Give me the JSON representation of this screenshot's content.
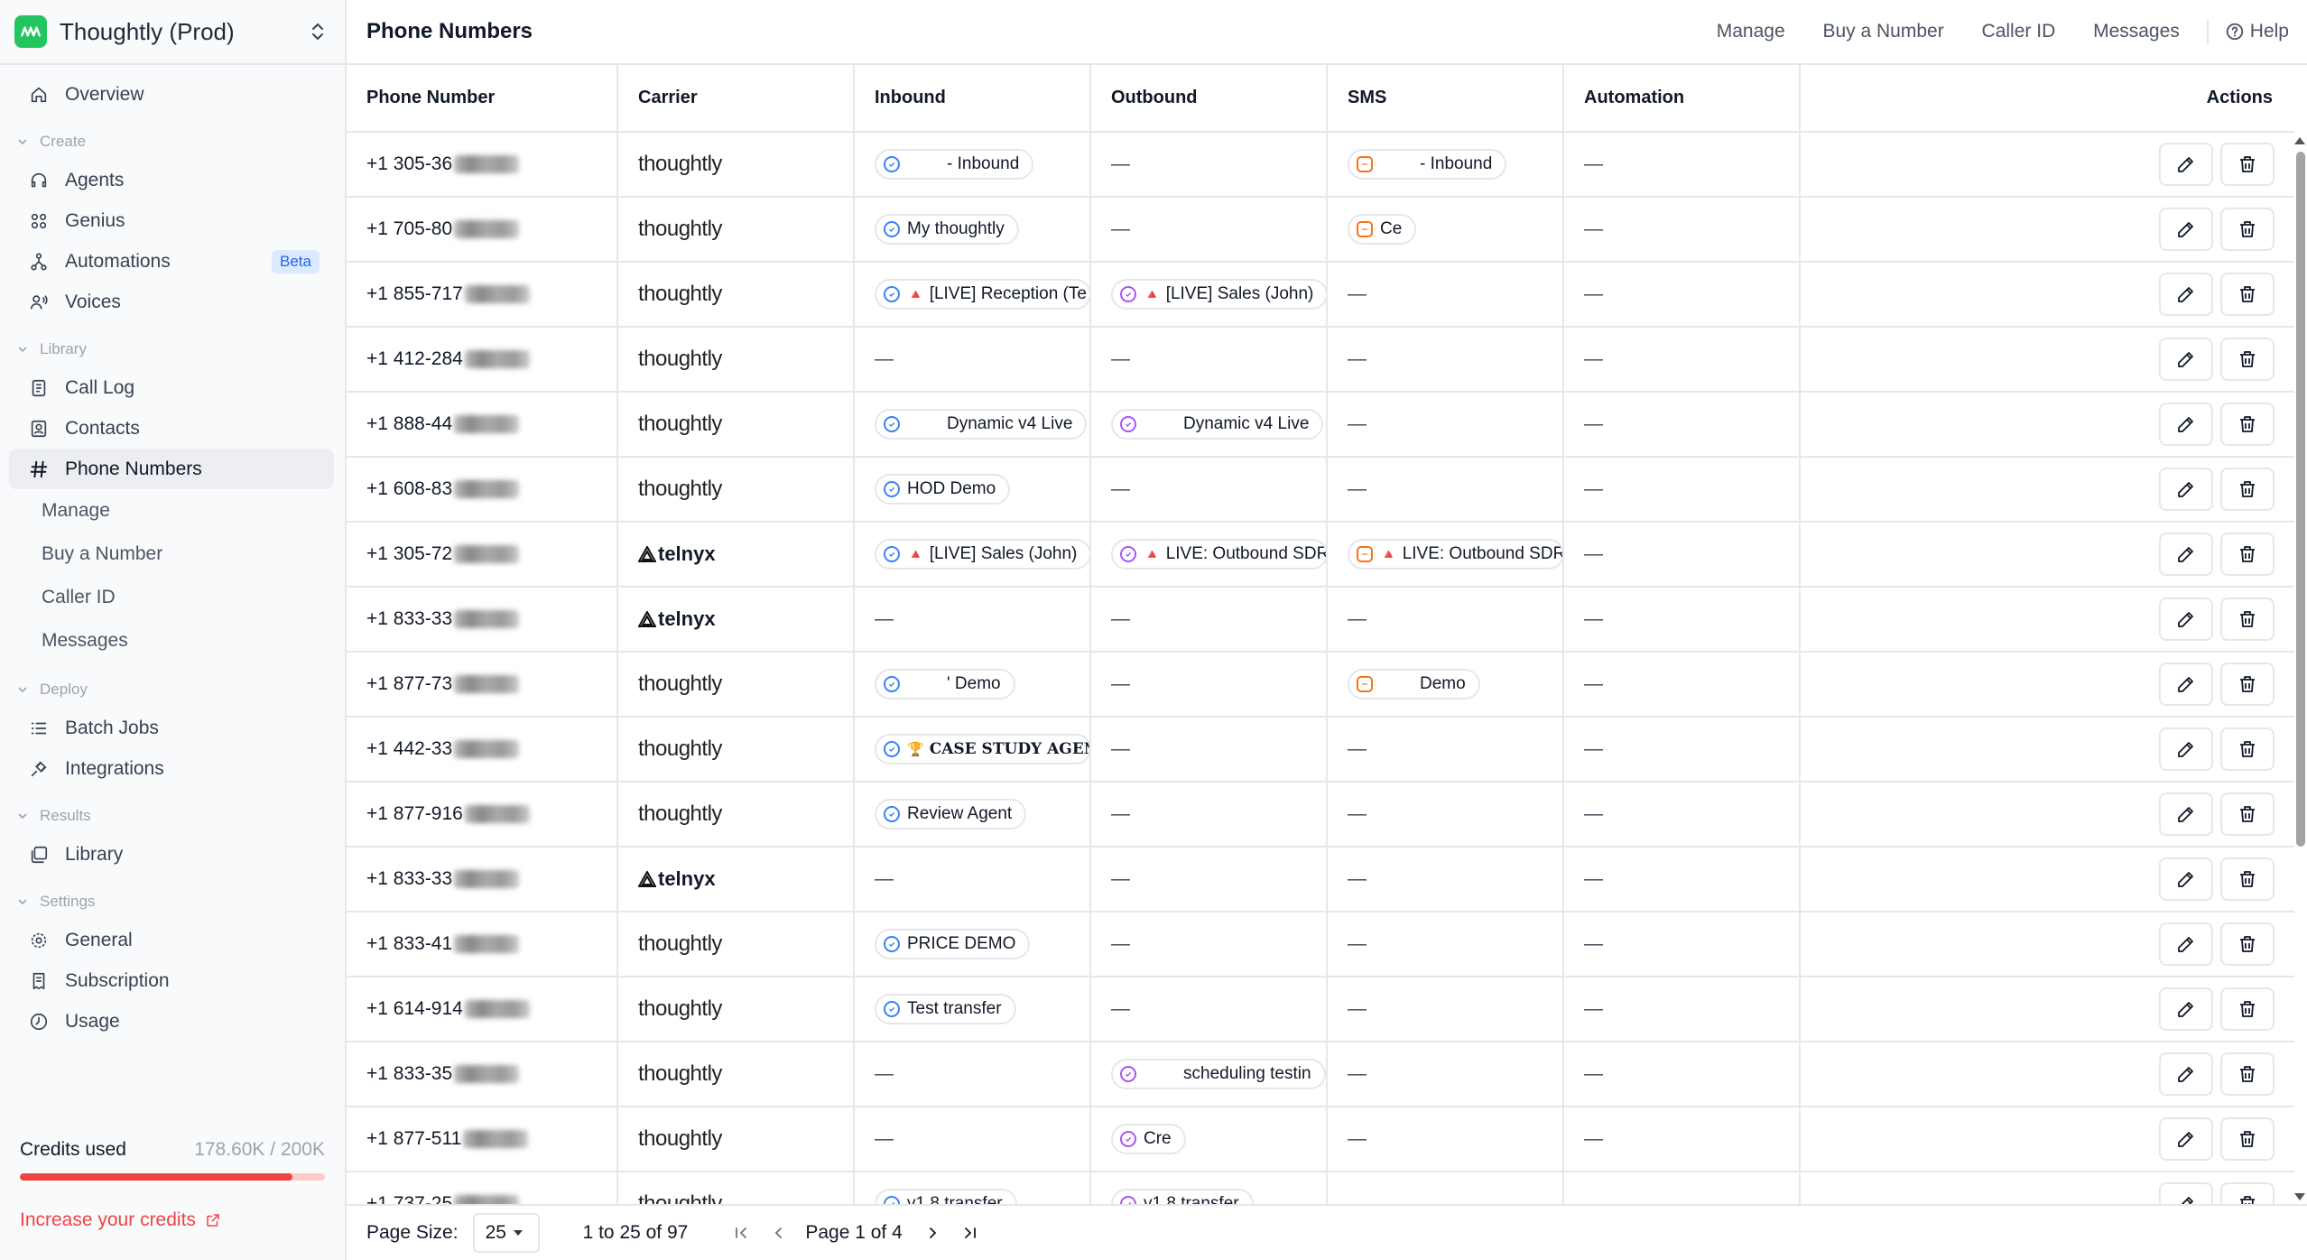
{
  "workspace": {
    "name": "Thoughtly (Prod)"
  },
  "sidebar": {
    "overview": "Overview",
    "sections": {
      "create": "Create",
      "library": "Library",
      "deploy": "Deploy",
      "results": "Results",
      "settings": "Settings"
    },
    "create_items": [
      {
        "label": "Agents",
        "icon": "headset-icon"
      },
      {
        "label": "Genius",
        "icon": "grid-icon"
      },
      {
        "label": "Automations",
        "icon": "flow-icon",
        "badge": "Beta"
      },
      {
        "label": "Voices",
        "icon": "voices-icon"
      }
    ],
    "library_items": [
      {
        "label": "Call Log",
        "icon": "call-log-icon"
      },
      {
        "label": "Contacts",
        "icon": "contacts-icon"
      },
      {
        "label": "Phone Numbers",
        "icon": "hash-icon"
      }
    ],
    "phone_sub": [
      "Manage",
      "Buy a Number",
      "Caller ID",
      "Messages"
    ],
    "deploy_items": [
      {
        "label": "Batch Jobs",
        "icon": "list-icon"
      },
      {
        "label": "Integrations",
        "icon": "plug-icon"
      }
    ],
    "results_items": [
      {
        "label": "Library",
        "icon": "library-icon"
      }
    ],
    "settings_items": [
      {
        "label": "General",
        "icon": "gear-icon"
      },
      {
        "label": "Subscription",
        "icon": "receipt-icon"
      },
      {
        "label": "Usage",
        "icon": "clock-icon"
      }
    ],
    "credits": {
      "label": "Credits used",
      "value": "178.60K / 200K",
      "fraction": 0.893
    },
    "increase": "Increase your credits"
  },
  "header": {
    "title": "Phone Numbers",
    "nav": [
      "Manage",
      "Buy a Number",
      "Caller ID",
      "Messages"
    ],
    "help": "Help"
  },
  "table": {
    "columns": [
      "Phone Number",
      "Carrier",
      "Inbound",
      "Outbound",
      "SMS",
      "Automation",
      "Actions"
    ],
    "rows": [
      {
        "phone": "+1 305-36",
        "carrier": "thoughtly",
        "inbound": "- Inbound",
        "in_redact": true,
        "outbound": "—",
        "sms": "- Inbound",
        "sms_redact": true,
        "automation": "—"
      },
      {
        "phone": "+1 705-80",
        "carrier": "thoughtly",
        "inbound": "My thoughtly",
        "outbound": "—",
        "sms": "Ce",
        "automation": "—"
      },
      {
        "phone": "+1 855-717",
        "carrier": "thoughtly",
        "inbound": "[LIVE] Reception (Te",
        "in_emoji": "🔺",
        "outbound": "[LIVE] Sales (John)",
        "out_emoji": "🔺",
        "sms": "—",
        "automation": "—"
      },
      {
        "phone": "+1 412-284",
        "carrier": "thoughtly",
        "inbound": "—",
        "outbound": "—",
        "sms": "—",
        "automation": "—"
      },
      {
        "phone": "+1 888-44",
        "carrier": "thoughtly",
        "inbound": "Dynamic v4 Live",
        "in_redact": true,
        "outbound": "Dynamic v4 Live",
        "out_redact": true,
        "sms": "—",
        "automation": "—"
      },
      {
        "phone": "+1 608-83",
        "carrier": "thoughtly",
        "inbound": "HOD Demo",
        "outbound": "—",
        "sms": "—",
        "automation": "—"
      },
      {
        "phone": "+1 305-72",
        "carrier": "telnyx",
        "inbound": "[LIVE] Sales (John)",
        "in_emoji": "🔺",
        "outbound": "LIVE: Outbound SDR",
        "out_emoji": "🔺",
        "sms": "LIVE: Outbound SDR",
        "sms_emoji": "🔺",
        "automation": "—"
      },
      {
        "phone": "+1 833-33",
        "carrier": "telnyx",
        "inbound": "—",
        "outbound": "—",
        "sms": "—",
        "automation": "—"
      },
      {
        "phone": "+1 877-73",
        "carrier": "thoughtly",
        "inbound": "' Demo",
        "in_redact": true,
        "outbound": "—",
        "sms": "Demo",
        "sms_redact": true,
        "automation": "—"
      },
      {
        "phone": "+1 442-33",
        "carrier": "thoughtly",
        "inbound": "CASE STUDY AGENT",
        "in_emoji": "🏆",
        "in_serif": true,
        "outbound": "—",
        "sms": "—",
        "automation": "—"
      },
      {
        "phone": "+1 877-916",
        "carrier": "thoughtly",
        "inbound": "Review Agent",
        "outbound": "—",
        "sms": "—",
        "automation": "—"
      },
      {
        "phone": "+1 833-33",
        "carrier": "telnyx",
        "inbound": "—",
        "outbound": "—",
        "sms": "—",
        "automation": "—"
      },
      {
        "phone": "+1 833-41",
        "carrier": "thoughtly",
        "inbound": "PRICE DEMO",
        "outbound": "—",
        "sms": "—",
        "automation": "—"
      },
      {
        "phone": "+1 614-914",
        "carrier": "thoughtly",
        "inbound": "Test transfer",
        "outbound": "—",
        "sms": "—",
        "automation": "—"
      },
      {
        "phone": "+1 833-35",
        "carrier": "thoughtly",
        "inbound": "—",
        "outbound": "scheduling testin",
        "out_redact": true,
        "sms": "—",
        "automation": "—"
      },
      {
        "phone": "+1 877-511",
        "carrier": "thoughtly",
        "inbound": "—",
        "outbound": "Cre",
        "sms": "—",
        "automation": "—"
      },
      {
        "phone": "+1 737-25",
        "carrier": "thoughtly",
        "inbound": "v1.8 transfer",
        "outbound": "v1.8 transfer",
        "sms": "—",
        "automation": "—"
      }
    ]
  },
  "pager": {
    "size_label": "Page Size:",
    "size": "25",
    "range": "1 to 25 of 97",
    "page": "Page 1 of 4"
  }
}
